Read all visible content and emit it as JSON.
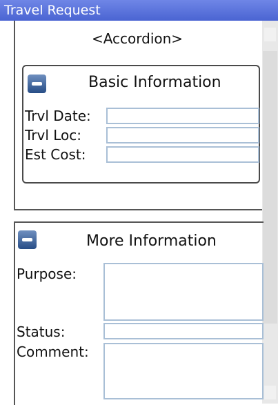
{
  "window": {
    "title": "Travel Request"
  },
  "accordion": {
    "title": "<Accordion>"
  },
  "basic": {
    "title": "Basic Information",
    "date_label": "Trvl Date:",
    "loc_label": "Trvl Loc:",
    "cost_label": "Est Cost:"
  },
  "more": {
    "title": "More Information",
    "purpose_label": "Purpose:",
    "status_label": "Status:",
    "comment_label": "Comment:"
  }
}
